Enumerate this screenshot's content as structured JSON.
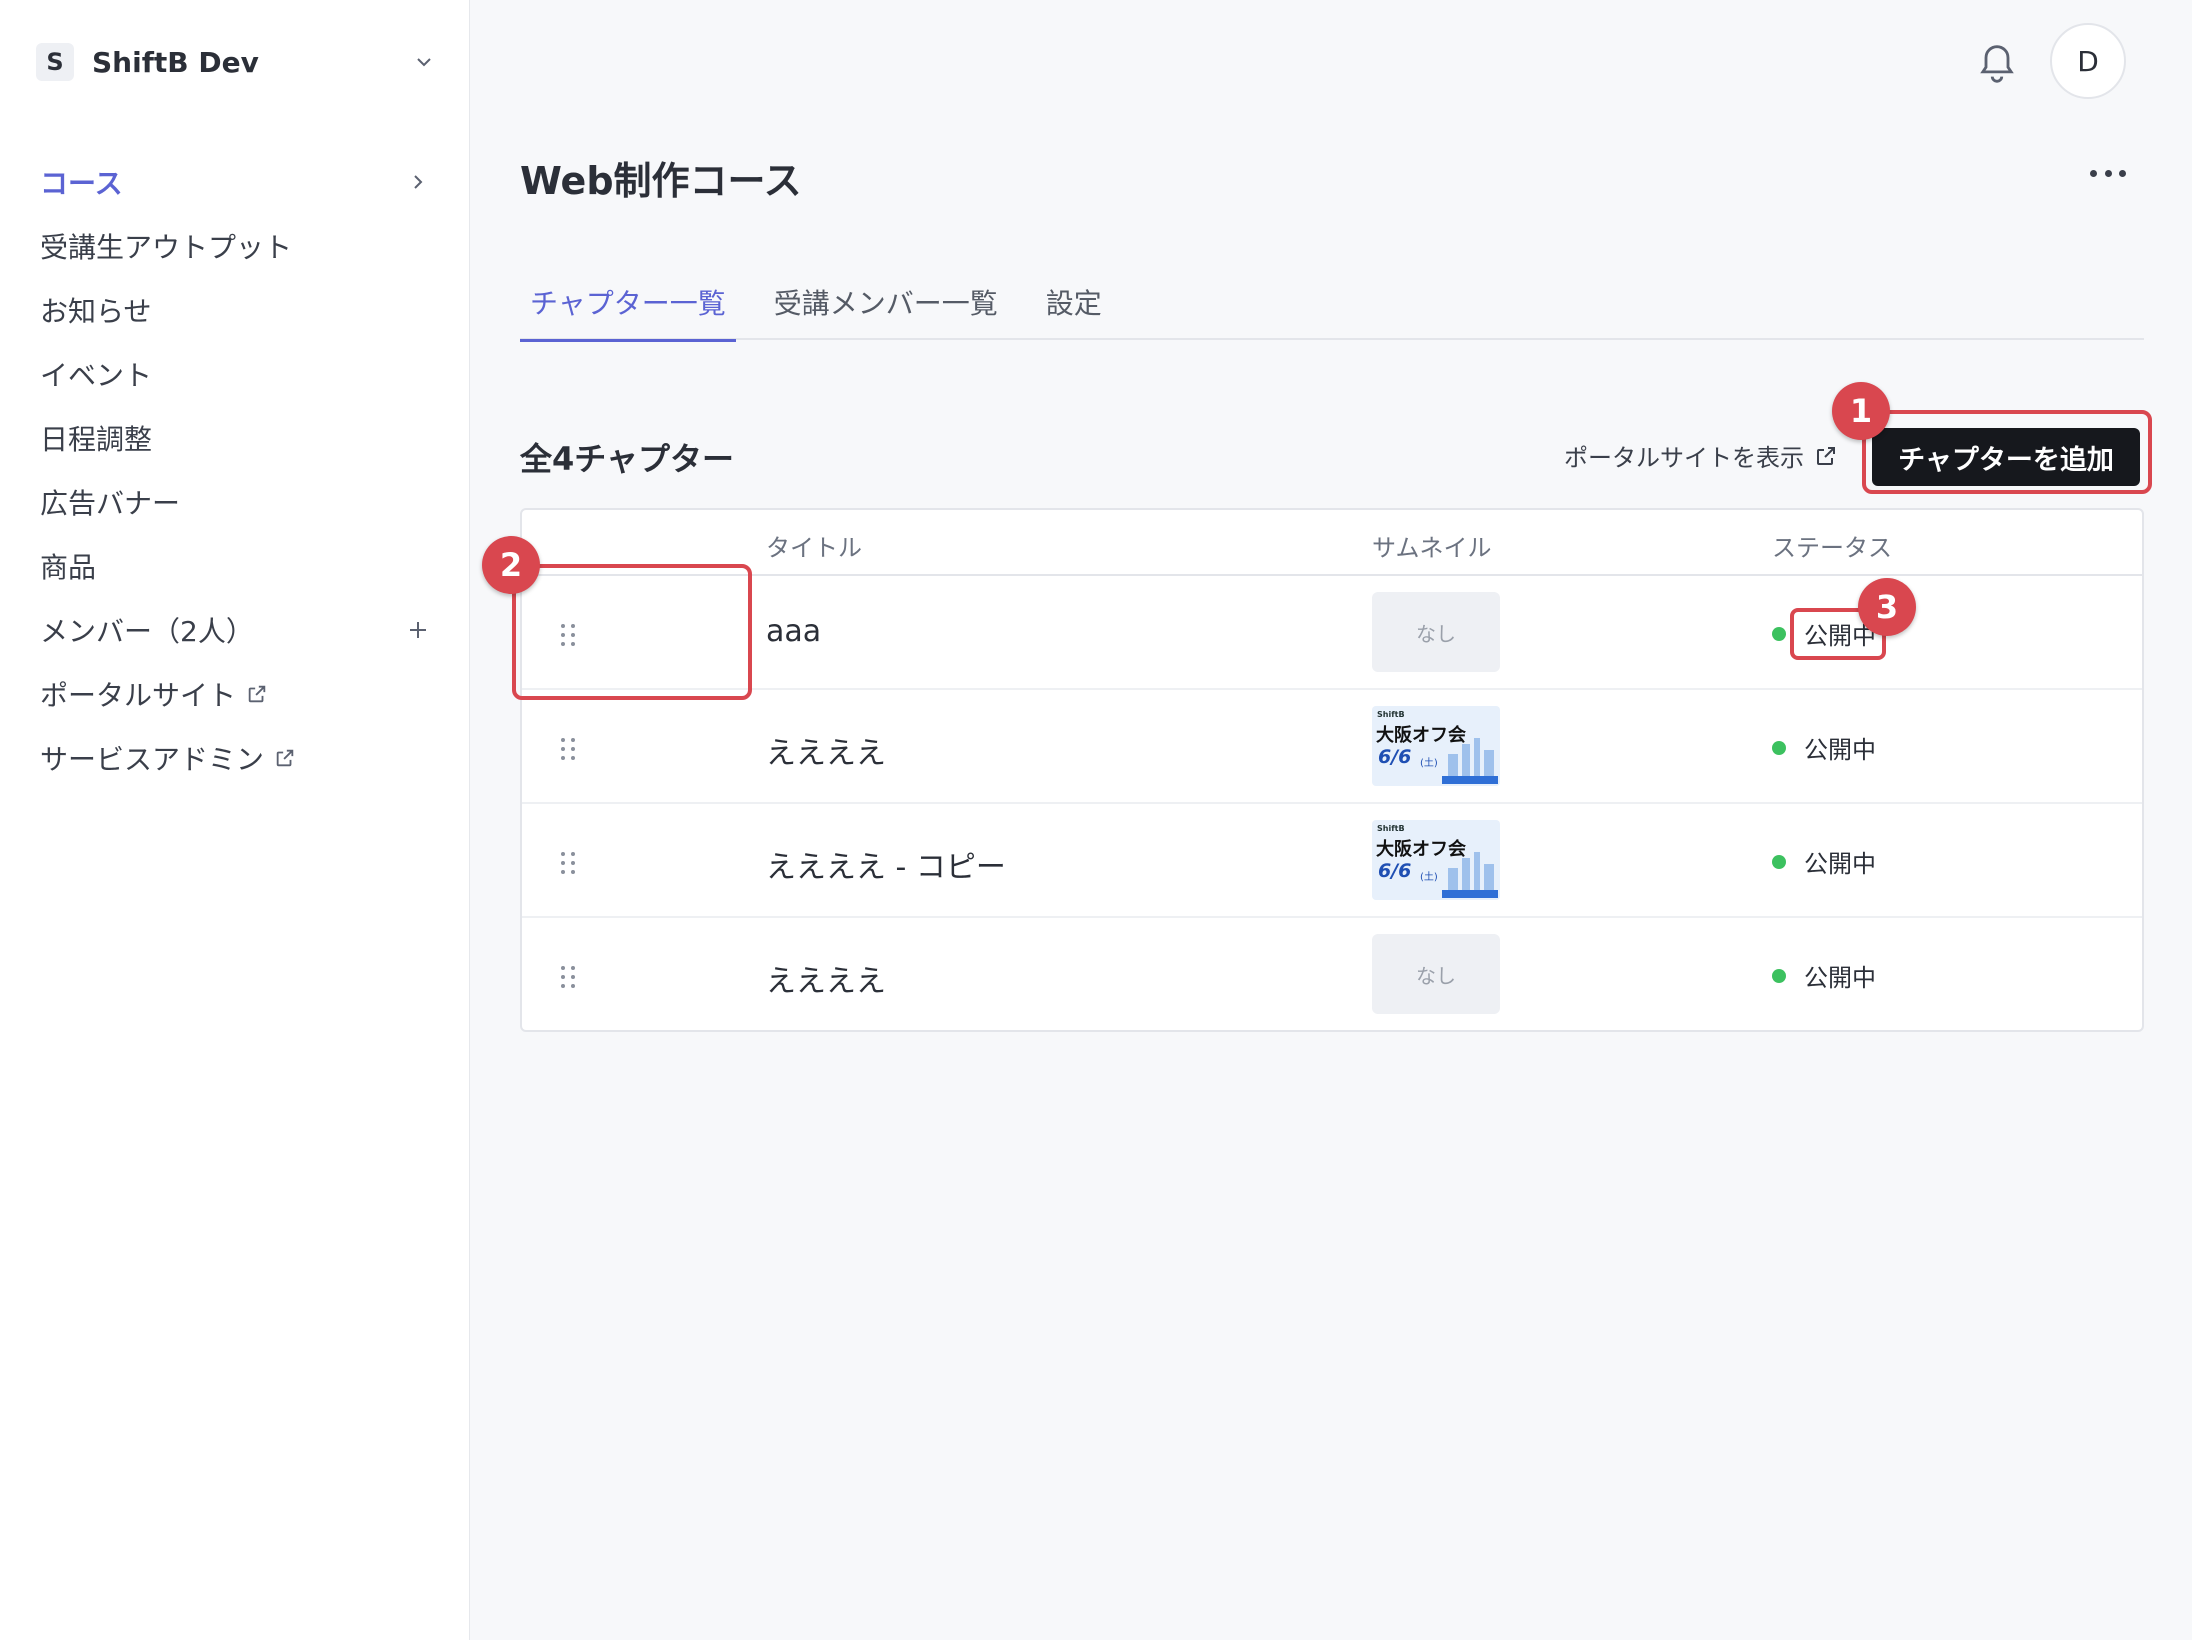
{
  "workspace": {
    "badge": "S",
    "name": "ShiftB Dev"
  },
  "sidebar": {
    "items": [
      {
        "label": "コース",
        "active": true
      },
      {
        "label": "受講生アウトプット"
      },
      {
        "label": "お知らせ"
      },
      {
        "label": "イベント"
      },
      {
        "label": "日程調整"
      },
      {
        "label": "広告バナー"
      },
      {
        "label": "商品"
      },
      {
        "label": "メンバー（2人）"
      },
      {
        "label": "ポータルサイト"
      },
      {
        "label": "サービスアドミン"
      }
    ]
  },
  "header": {
    "avatar": "D"
  },
  "page": {
    "title": "Web制作コース",
    "tabs": [
      {
        "label": "チャプター一覧",
        "active": true
      },
      {
        "label": "受講メンバー一覧"
      },
      {
        "label": "設定"
      }
    ],
    "count_label": "全4チャプター",
    "portal_link": "ポータルサイトを表示",
    "add_button": "チャプターを追加"
  },
  "table": {
    "headers": {
      "title": "タイトル",
      "thumbnail": "サムネイル",
      "status": "ステータス"
    },
    "rows": [
      {
        "title": "aaa",
        "thumbnail": "なし",
        "status": "公開中"
      },
      {
        "title": "ええええ",
        "thumbnail_image": {
          "brand": "ShiftB",
          "event": "大阪オフ会",
          "date": "6/6",
          "day": "(土)"
        },
        "status": "公開中"
      },
      {
        "title": "ええええ - コピー",
        "thumbnail_image": {
          "brand": "ShiftB",
          "event": "大阪オフ会",
          "date": "6/6",
          "day": "(土)"
        },
        "status": "公開中"
      },
      {
        "title": "ええええ",
        "thumbnail": "なし",
        "status": "公開中"
      }
    ]
  },
  "annotations": [
    "1",
    "2",
    "3"
  ],
  "colors": {
    "accent": "#5b63d3",
    "annotation": "#d9474f",
    "status_green": "#3cc15f",
    "primary_button": "#16181d"
  }
}
